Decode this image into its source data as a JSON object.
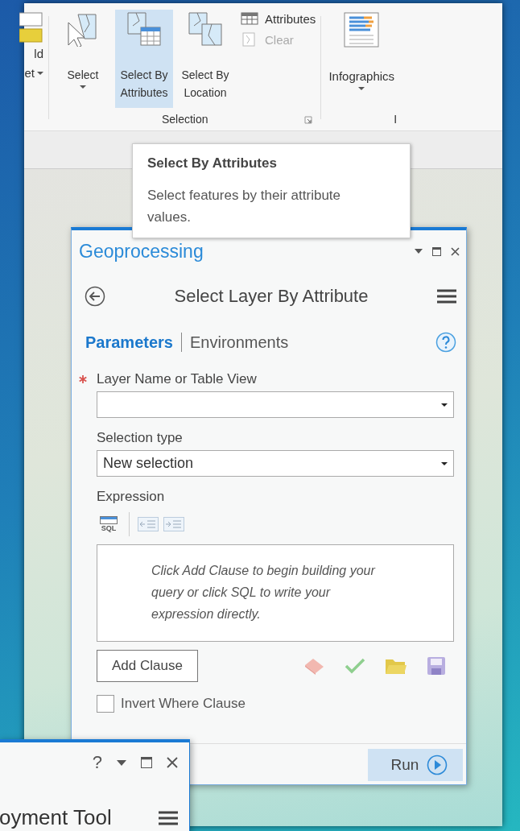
{
  "ribbon": {
    "cut_button": {
      "lines": [
        "ld",
        "et"
      ],
      "dropdown": true
    },
    "selection_group": {
      "label": "Selection",
      "buttons": [
        {
          "label": "Select",
          "dropdown": true,
          "selected": false
        },
        {
          "label": "Select By Attributes",
          "dropdown": false,
          "selected": true
        },
        {
          "label": "Select By Location",
          "dropdown": false,
          "selected": false
        }
      ],
      "small_buttons": [
        {
          "label": "Attributes",
          "disabled": false
        },
        {
          "label": "Clear",
          "disabled": true
        }
      ]
    },
    "infographics": {
      "label": "Infographics",
      "dropdown": true
    },
    "cut_group_label": "I"
  },
  "tooltip": {
    "title": "Select By Attributes",
    "description": "Select features by their attribute values."
  },
  "geoprocessing": {
    "title": "Geoprocessing",
    "tool_title": "Select Layer By Attribute",
    "tabs": [
      {
        "label": "Parameters",
        "selected": true
      },
      {
        "label": "Environments",
        "selected": false
      }
    ],
    "parameters": [
      {
        "label": "Layer Name or Table View",
        "required": true
      },
      {
        "label": "Selection type",
        "required": false,
        "value": "New selection"
      }
    ],
    "expression": {
      "label": "Expression",
      "sql_button": "SQL",
      "hint": "Click Add Clause to begin building your query or click SQL to write your expression directly.",
      "add_clause_button": "Add Clause"
    },
    "invert_checkbox": {
      "label": "Invert Where Clause",
      "checked": false
    },
    "run_button": "Run"
  },
  "second_pane": {
    "help": "?",
    "title": "oyment Tool"
  }
}
